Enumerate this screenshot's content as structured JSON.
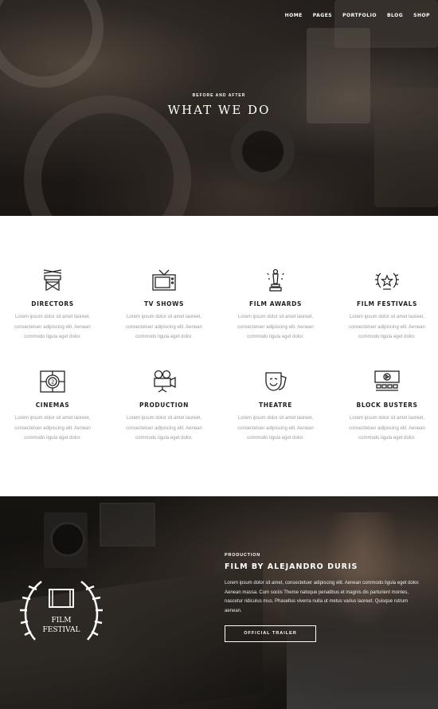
{
  "nav": {
    "items": [
      "HOME",
      "PAGES",
      "PORTFOLIO",
      "BLOG",
      "SHOP"
    ]
  },
  "hero": {
    "eyebrow": "BEFORE AND AFTER",
    "title": "WHAT WE DO"
  },
  "services": [
    {
      "icon": "directors-chair-icon",
      "title": "DIRECTORS",
      "desc": "Lorem ipsum dolor sit amet laoreet, consectetuer adipiscing elit. Aenean commodo ligula eget dolor."
    },
    {
      "icon": "tv-icon",
      "title": "TV SHOWS",
      "desc": "Lorem ipsum dolor sit amet laoreet, consectetuer adipiscing elit. Aenean commodo ligula eget dolor."
    },
    {
      "icon": "award-statue-icon",
      "title": "FILM AWARDS",
      "desc": "Lorem ipsum dolor sit amet laoreet, consectetuer adipiscing elit. Aenean commodo ligula eget dolor."
    },
    {
      "icon": "laurel-star-icon",
      "title": "FILM FESTIVALS",
      "desc": "Lorem ipsum dolor sit amet laoreet, consectetuer adipiscing elit. Aenean commodo ligula eget dolor."
    },
    {
      "icon": "film-countdown-icon",
      "title": "CINEMAS",
      "desc": "Lorem ipsum dolor sit amet laoreet, consectetuer adipiscing elit. Aenean commodo ligula eget dolor."
    },
    {
      "icon": "film-camera-icon",
      "title": "PRODUCTION",
      "desc": "Lorem ipsum dolor sit amet laoreet, consectetuer adipiscing elit. Aenean commodo ligula eget dolor."
    },
    {
      "icon": "theatre-masks-icon",
      "title": "THEATRE",
      "desc": "Lorem ipsum dolor sit amet laoreet, consectetuer adipiscing elit. Aenean commodo ligula eget dolor."
    },
    {
      "icon": "cinema-seats-icon",
      "title": "BLOCK BUSTERS",
      "desc": "Lorem ipsum dolor sit amet laoreet, consectetuer adipiscing elit. Aenean commodo ligula eget dolor."
    }
  ],
  "festival_badge": {
    "line1": "FILM",
    "line2": "FESTIVAL"
  },
  "feature": {
    "eyebrow": "PRODUCTION",
    "title": "FILM BY ALEJANDRO DURIS",
    "desc": "Lorem ipsum dolor sit amet, consectetuer adipiscing elit. Aenean commodo ligula eget dolor. Aenean massa. Cum sociis Theme natoque penatibus et magnis dis parturient montes, nascetur ridiculus mus. Phasellus viverra nulla ut metus varius laoreet. Quisque rutrum aenean.",
    "button": "OFFICIAL TRAILER"
  },
  "colors": {
    "accent": "#ffffff",
    "text_dark": "#222222",
    "text_muted": "#9a9a9a"
  }
}
